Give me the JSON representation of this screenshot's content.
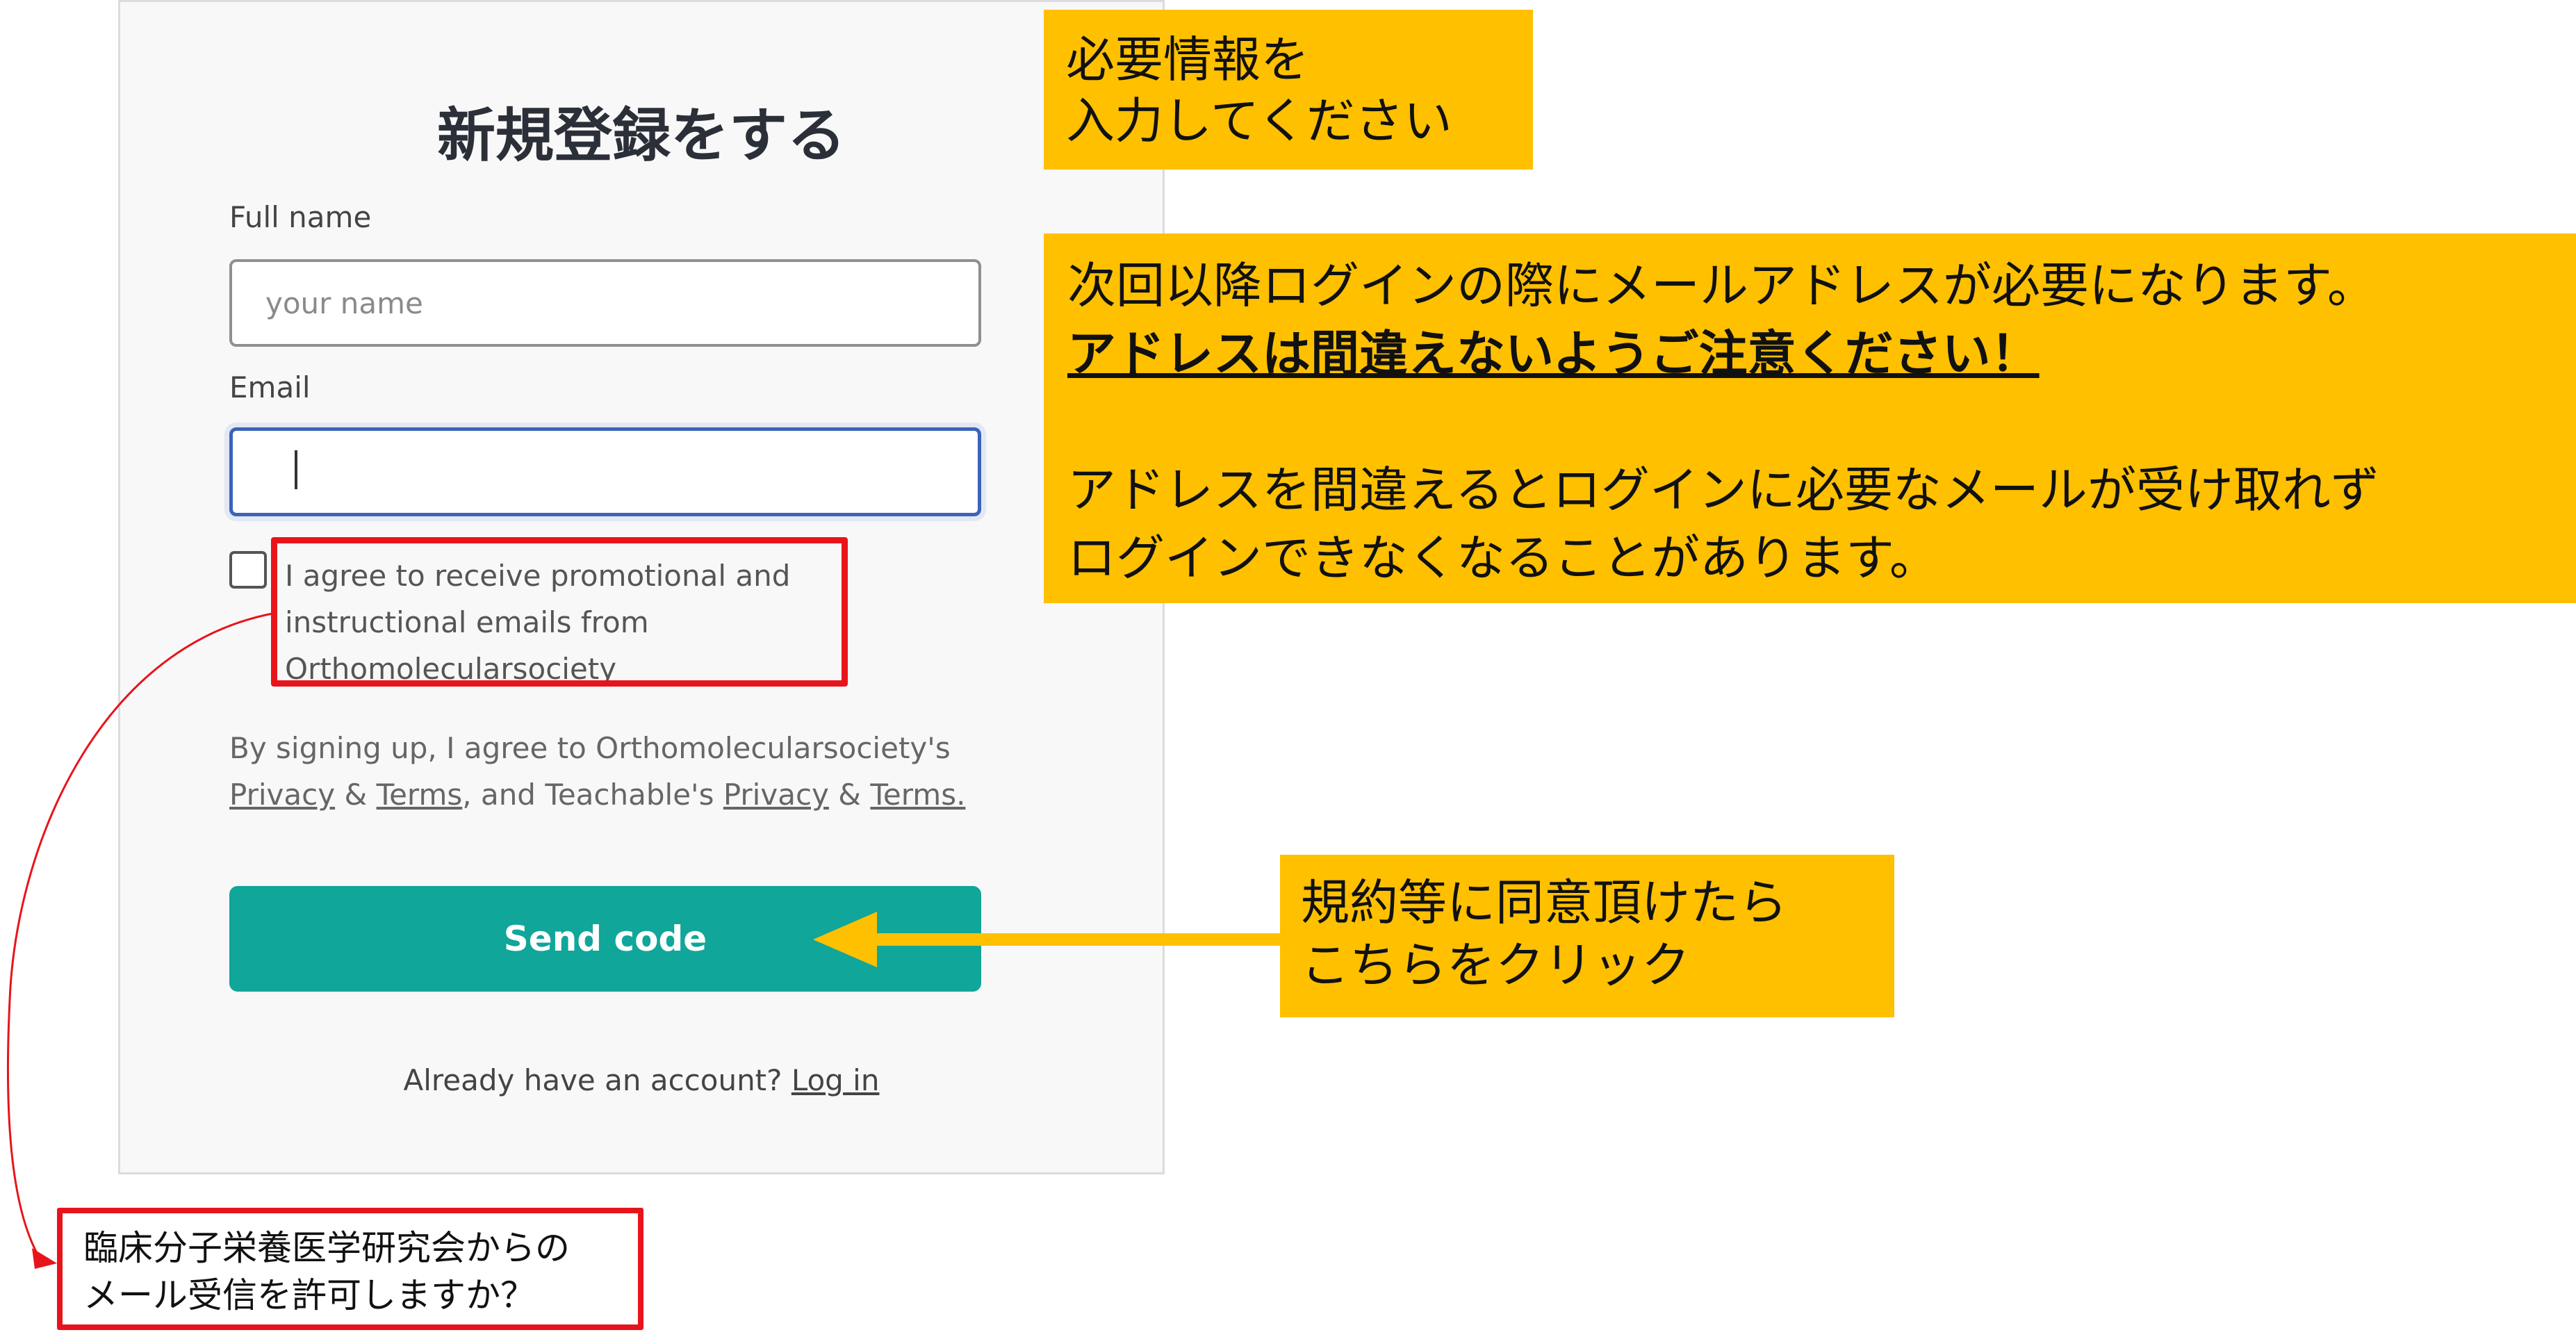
{
  "form": {
    "title": "新規登録をする",
    "full_name_label": "Full name",
    "full_name_placeholder": "your name",
    "full_name_value": "",
    "email_label": "Email",
    "email_value": "",
    "agree_checked": false,
    "agree_text": "I agree to receive promotional and instructional emails from Orthomolecularsociety",
    "terms_prefix": "By signing up, I agree to Orthomolecularsociety's",
    "privacy_link_1": "Privacy",
    "amp_1": "&",
    "terms_link_1": "Terms",
    "terms_middle": ", and Teachable's",
    "privacy_link_2": "Privacy",
    "amp_2": "&",
    "terms_link_2": "Terms.",
    "send_button": "Send code",
    "already_text": "Already have an account?",
    "login_link": "Log in"
  },
  "annotations": {
    "note_1_line_1": "必要情報を",
    "note_1_line_2": "入力してください",
    "note_2_line_1": "次回以降ログインの際にメールアドレスが必要になります。",
    "note_2_line_2": "アドレスは間違えないようご注意ください！",
    "note_2_line_3": "アドレスを間違えるとログインに必要なメールが受け取れず",
    "note_2_line_4": "ログインできなくなることがあります。",
    "note_3_line_1": "規約等に同意頂けたら",
    "note_3_line_2": "こちらをクリック",
    "note_4_line_1": "臨床分子栄養医学研究会からの",
    "note_4_line_2": "メール受信を許可しますか？"
  },
  "colors": {
    "accent_teal": "#10a69a",
    "annotation_yellow": "#ffc000",
    "highlight_red": "#e8141b",
    "focus_blue": "#3d63b8"
  }
}
